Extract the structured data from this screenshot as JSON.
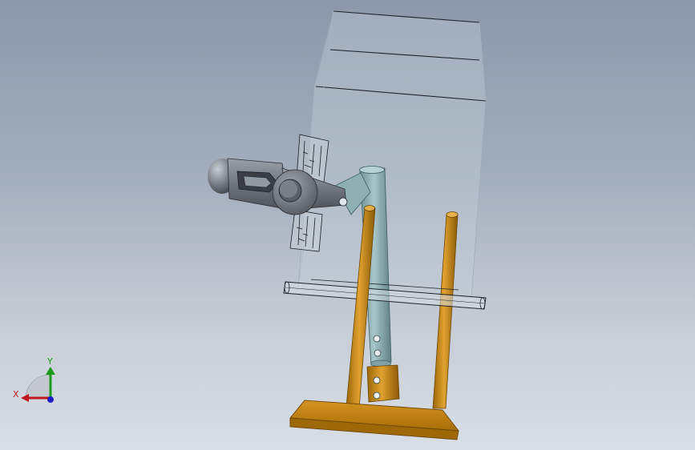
{
  "triad": {
    "x_label": "X",
    "y_label": "Y",
    "x_color": "#c0171f",
    "y_color": "#1c9a1c",
    "z_color": "#1c1cc8"
  },
  "colors": {
    "background_top": "#8c98a8",
    "background_bottom": "#d9dee5",
    "frame": "#c98a16",
    "frame_dark": "#8a5a06",
    "tube": "#8eb0b5",
    "housing": "#6c7279",
    "glass": "#c8d4dc"
  }
}
